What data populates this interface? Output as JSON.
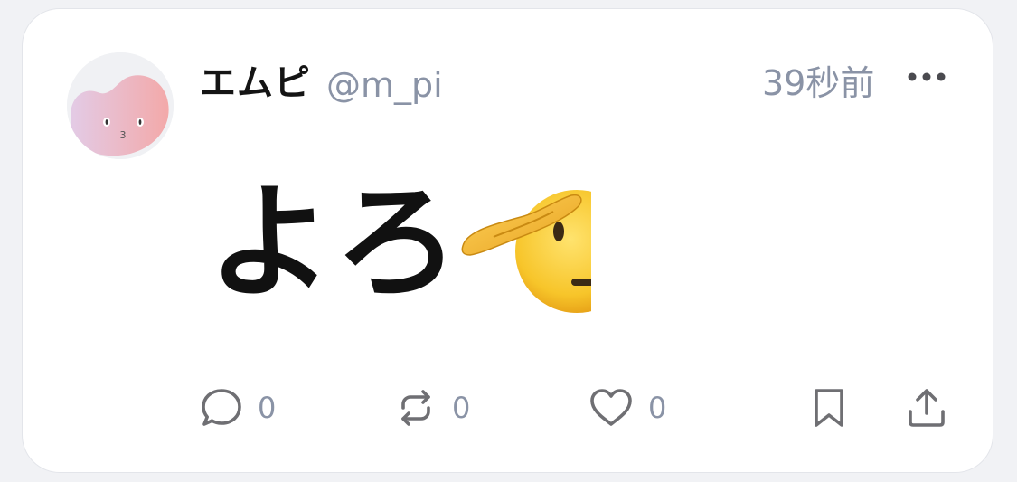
{
  "post": {
    "author": {
      "display_name": "エムピ",
      "handle": "@m_pi",
      "avatar_icon": "avatar-blob-face"
    },
    "timestamp": "39秒前",
    "text": "よろ",
    "emoji": "saluting-face",
    "actions": {
      "reply_count": "0",
      "repost_count": "0",
      "like_count": "0"
    }
  },
  "colors": {
    "text_primary": "#141414",
    "text_secondary": "#8a93a6",
    "icon": "#6f6f73",
    "card_background": "#ffffff",
    "page_background": "#f1f2f5"
  }
}
